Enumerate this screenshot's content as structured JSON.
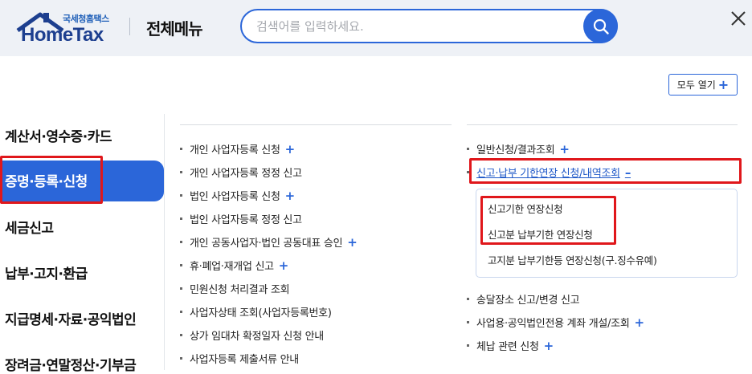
{
  "header": {
    "logo_small": "국세청홈택스",
    "logo_main": "HomeTax",
    "title": "전체메뉴",
    "search_placeholder": "검색어를 입력하세요."
  },
  "expand_all_label": "모두 열기",
  "categories": [
    {
      "label": "계산서·영수증·카드"
    },
    {
      "label": "증명·등록·신청",
      "active": true
    },
    {
      "label": "세금신고"
    },
    {
      "label": "납부·고지·환급"
    },
    {
      "label": "지급명세·자료·공익법인"
    },
    {
      "label": "장려금·연말정산·기부금"
    }
  ],
  "left_column": [
    {
      "label": "개인 사업자등록 신청",
      "expandable": true
    },
    {
      "label": "개인 사업자등록 정정 신고",
      "expandable": false
    },
    {
      "label": "법인 사업자등록 신청",
      "expandable": true
    },
    {
      "label": "법인 사업자등록 정정 신고",
      "expandable": false
    },
    {
      "label": "개인 공동사업자·법인 공동대표 승인",
      "expandable": true
    },
    {
      "label": "휴·폐업·재개업 신고",
      "expandable": true
    },
    {
      "label": "민원신청 처리결과 조회",
      "expandable": false
    },
    {
      "label": "사업자상태 조회(사업자등록번호)",
      "expandable": false
    },
    {
      "label": "상가 임대차 확정일자 신청 안내",
      "expandable": false
    },
    {
      "label": "사업자등록 제출서류 안내",
      "expandable": false
    }
  ],
  "right_column": {
    "top_items": [
      {
        "label": "일반신청/결과조회",
        "expandable": true
      }
    ],
    "expanded_item": {
      "label": "신고·납부 기한연장 신청/내역조회",
      "sub_items": [
        {
          "label": "신고기한 연장신청"
        },
        {
          "label": "신고분 납부기한 연장신청"
        },
        {
          "label": "고지분 납부기한등 연장신청(구.징수유예)"
        }
      ]
    },
    "bottom_items": [
      {
        "label": "송달장소 신고/변경 신고",
        "expandable": false
      },
      {
        "label": "사업용·공익법인전용 계좌 개설/조회",
        "expandable": true
      },
      {
        "label": "체납 관련 신청",
        "expandable": true
      }
    ]
  },
  "colors": {
    "accent": "#2b66d9",
    "highlight": "#e0171b",
    "header_bg": "#eef1f6"
  }
}
